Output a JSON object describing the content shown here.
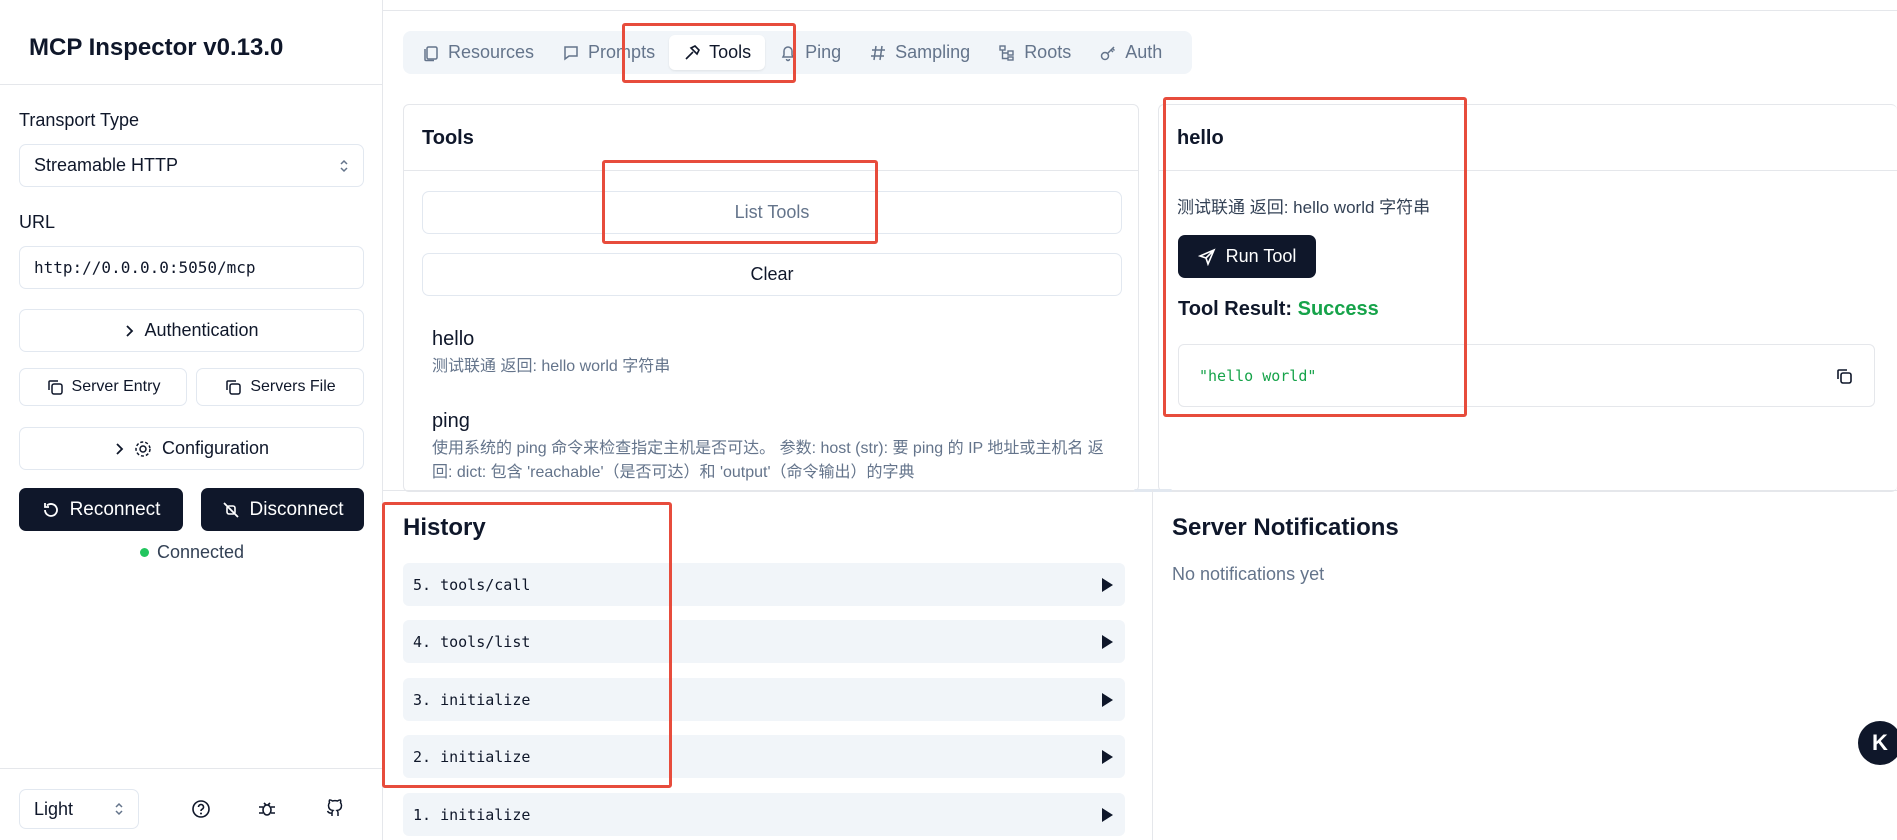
{
  "sidebar": {
    "title": "MCP Inspector v0.13.0",
    "transport_label": "Transport Type",
    "transport_value": "Streamable HTTP",
    "url_label": "URL",
    "url_value": "http://0.0.0.0:5050/mcp",
    "authentication_label": "Authentication",
    "server_entry_label": "Server Entry",
    "servers_file_label": "Servers File",
    "configuration_label": "Configuration",
    "reconnect_label": "Reconnect",
    "disconnect_label": "Disconnect",
    "status_text": "Connected",
    "status_color": "#22c55e",
    "theme_value": "Light"
  },
  "tabs": [
    {
      "label": "Resources",
      "icon": "files-icon"
    },
    {
      "label": "Prompts",
      "icon": "message-icon"
    },
    {
      "label": "Tools",
      "icon": "hammer-icon",
      "active": true
    },
    {
      "label": "Ping",
      "icon": "bell-icon"
    },
    {
      "label": "Sampling",
      "icon": "hash-icon"
    },
    {
      "label": "Roots",
      "icon": "tree-icon"
    },
    {
      "label": "Auth",
      "icon": "key-icon"
    }
  ],
  "tools_panel": {
    "title": "Tools",
    "list_button": "List Tools",
    "clear_button": "Clear",
    "items": [
      {
        "name": "hello",
        "description": "测试联通 返回: hello world 字符串"
      },
      {
        "name": "ping",
        "description": "使用系统的 ping 命令来检查指定主机是否可达。 参数: host (str): 要 ping 的 IP 地址或主机名 返回: dict: 包含 'reachable'（是否可达）和 'output'（命令输出）的字典"
      }
    ]
  },
  "tool_detail": {
    "title": "hello",
    "description": "测试联通 返回: hello world 字符串",
    "run_button": "Run Tool",
    "result_label": "Tool Result:",
    "result_status": "Success",
    "result_value": "\"hello world\""
  },
  "history": {
    "title": "History",
    "items": [
      "5. tools/call",
      "4. tools/list",
      "3. initialize",
      "2. initialize",
      "1. initialize"
    ]
  },
  "notifications": {
    "title": "Server Notifications",
    "empty_text": "No notifications yet"
  },
  "colors": {
    "accent_dark": "#0f172a",
    "success": "#16a34a",
    "highlight": "#e74c3c"
  }
}
